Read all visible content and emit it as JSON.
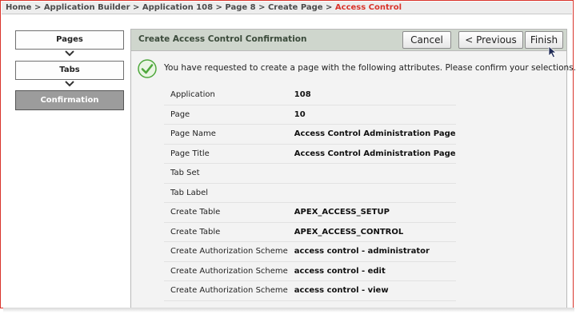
{
  "breadcrumb": {
    "items": [
      "Home",
      "Application Builder",
      "Application 108",
      "Page 8",
      "Create Page",
      "Access Control"
    ],
    "separator": ">"
  },
  "wizard": {
    "steps": [
      {
        "label": "Pages",
        "active": false
      },
      {
        "label": "Tabs",
        "active": false
      },
      {
        "label": "Confirmation",
        "active": true
      }
    ]
  },
  "panel": {
    "title": "Create Access Control Confirmation",
    "buttons": {
      "cancel": "Cancel",
      "previous": "< Previous",
      "finish": "Finish"
    },
    "message": "You have requested to create a page with the following attributes. Please confirm your selections.",
    "attributes": [
      {
        "label": "Application",
        "value": "108"
      },
      {
        "label": "Page",
        "value": "10"
      },
      {
        "label": "Page Name",
        "value": "Access Control Administration Page"
      },
      {
        "label": "Page Title",
        "value": "Access Control Administration Page"
      },
      {
        "label": "Tab Set",
        "value": ""
      },
      {
        "label": "Tab Label",
        "value": ""
      },
      {
        "label": "Create Table",
        "value": "APEX_ACCESS_SETUP"
      },
      {
        "label": "Create Table",
        "value": "APEX_ACCESS_CONTROL"
      },
      {
        "label": "Create Authorization Scheme",
        "value": "access control - administrator"
      },
      {
        "label": "Create Authorization Scheme",
        "value": "access control - edit"
      },
      {
        "label": "Create Authorization Scheme",
        "value": "access control - view"
      }
    ]
  },
  "colors": {
    "breadcrumb_current": "#d9342b",
    "panel_header": "#cfd6cd",
    "active_step": "#9c9c9c",
    "check_icon": "#4fa83d"
  },
  "icons": {
    "confirm": "check-circle-icon",
    "step_connector": "chevron-down-icon",
    "pointer": "mouse-cursor-icon"
  }
}
